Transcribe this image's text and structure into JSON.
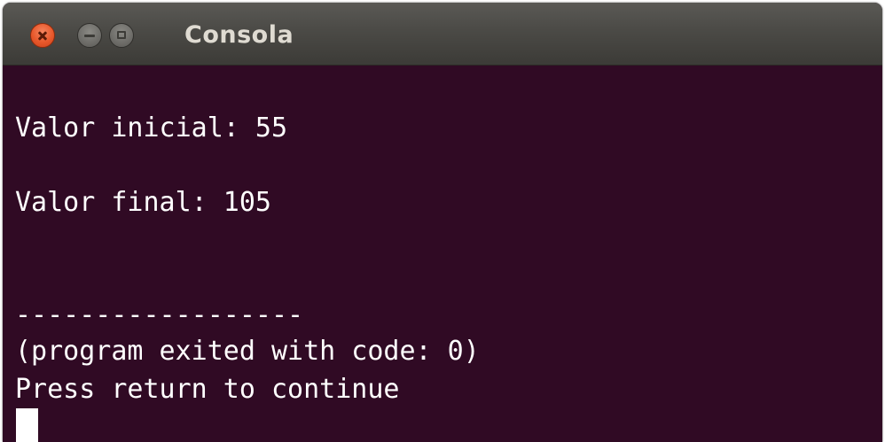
{
  "window": {
    "title": "Consola",
    "buttons": {
      "close": "close-icon",
      "minimize": "minimize-icon",
      "maximize": "maximize-icon"
    },
    "colors": {
      "terminal_background": "#300a24",
      "terminal_text": "#ffffff",
      "titlebar": "#3c3b37",
      "close_button": "#e8582b"
    }
  },
  "terminal": {
    "lines": [
      "Valor inicial: 55",
      "Valor final: 105",
      "------------------",
      "(program exited with code: 0)",
      "Press return to continue"
    ]
  }
}
